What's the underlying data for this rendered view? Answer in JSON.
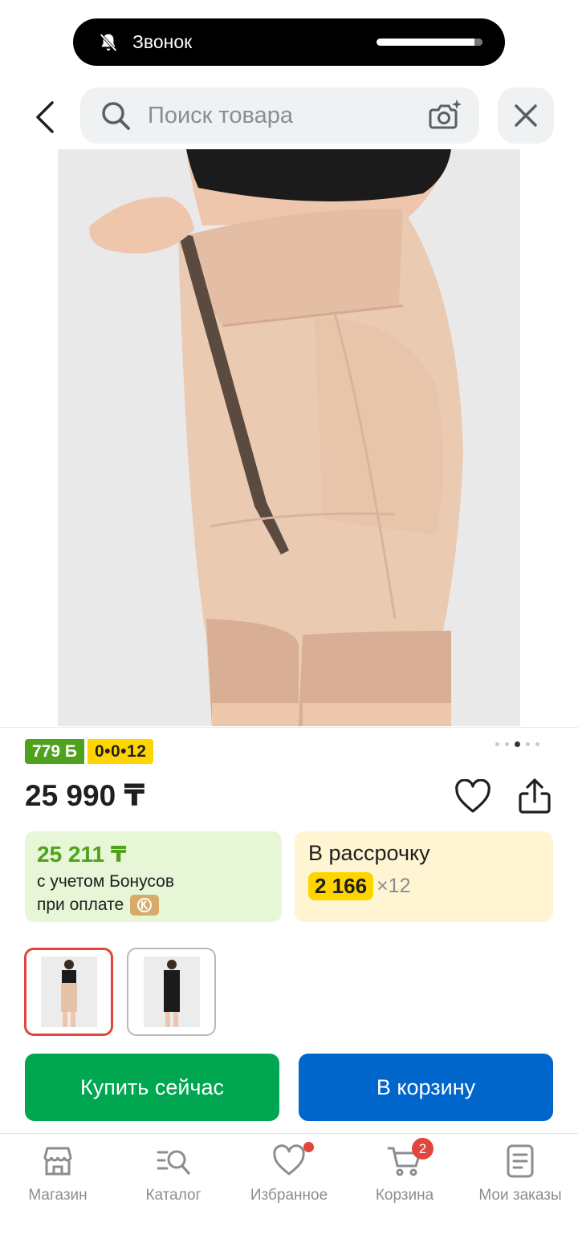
{
  "status": {
    "call_label": "Звонок",
    "bell_icon": "bell-off-icon"
  },
  "header": {
    "back_icon": "chevron-left-icon",
    "search_placeholder": "Поиск товара",
    "search_icon": "search-icon",
    "camera_icon": "camera-search-icon",
    "close_icon": "close-icon"
  },
  "gallery": {
    "slide_count": 5,
    "active_slide": 3
  },
  "product": {
    "bonus_badge": "779 Б",
    "installment_badge": "0•0•12",
    "price": "25 990 ₸",
    "bonus_card": {
      "price": "25 211 ₸",
      "line1": "с учетом Бонусов",
      "line2": "при оплате"
    },
    "credit_card": {
      "title": "В рассрочку",
      "amount": "2 166",
      "months": "×12"
    }
  },
  "actions": {
    "buy_now": "Купить сейчас",
    "add_to_cart": "В корзину"
  },
  "bottom_nav": {
    "items": [
      {
        "label": "Магазин",
        "icon": "store-icon"
      },
      {
        "label": "Каталог",
        "icon": "catalog-search-icon"
      },
      {
        "label": "Избранное",
        "icon": "heart-icon"
      },
      {
        "label": "Корзина",
        "icon": "cart-icon",
        "badge": "2"
      },
      {
        "label": "Мои заказы",
        "icon": "orders-icon"
      }
    ]
  },
  "colors": {
    "accent_green": "#00a650",
    "accent_blue": "#0066cc",
    "bonus_green": "#4fa21c",
    "installment_yellow": "#ffd500",
    "badge_red": "#e0463b"
  }
}
